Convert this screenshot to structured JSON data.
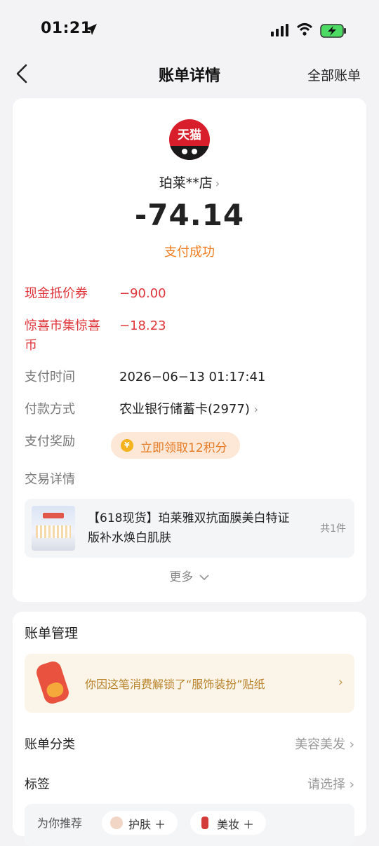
{
  "status_bar": {
    "time": "01:21"
  },
  "nav": {
    "title": "账单详情",
    "right_link": "全部账单"
  },
  "merchant": {
    "logo_text": "天猫",
    "shop_name": "珀莱**店",
    "amount": "-74.14",
    "status": "支付成功"
  },
  "discounts": [
    {
      "label": "现金抵价券",
      "value": "−90.00"
    },
    {
      "label": "惊喜市集惊喜币",
      "value": "−18.23"
    }
  ],
  "details": {
    "pay_time_label": "支付时间",
    "pay_time": "2026−06−13 01:17:41",
    "pay_method_label": "付款方式",
    "pay_method": "农业银行储蓄卡(2977)",
    "reward_label": "支付奖励",
    "reward_text": "立即领取12积分",
    "trade_label": "交易详情"
  },
  "product": {
    "title": "【618现货】珀莱雅双抗面膜美白特证版补水焕白肌肤",
    "count": "共1件"
  },
  "more_label": "更多",
  "management": {
    "title": "账单管理",
    "sticker_text": "你因这笔消费解锁了“服饰装扮”贴纸",
    "category_label": "账单分类",
    "category_value": "美容美发",
    "tag_label": "标签",
    "tag_value": "请选择",
    "recommend_label": "为你推荐",
    "chips": [
      "护肤",
      "美妆"
    ]
  },
  "colors": {
    "accent_orange": "#ef7c1e",
    "discount_red": "#e0353a",
    "brand_red": "#d81e2a"
  }
}
